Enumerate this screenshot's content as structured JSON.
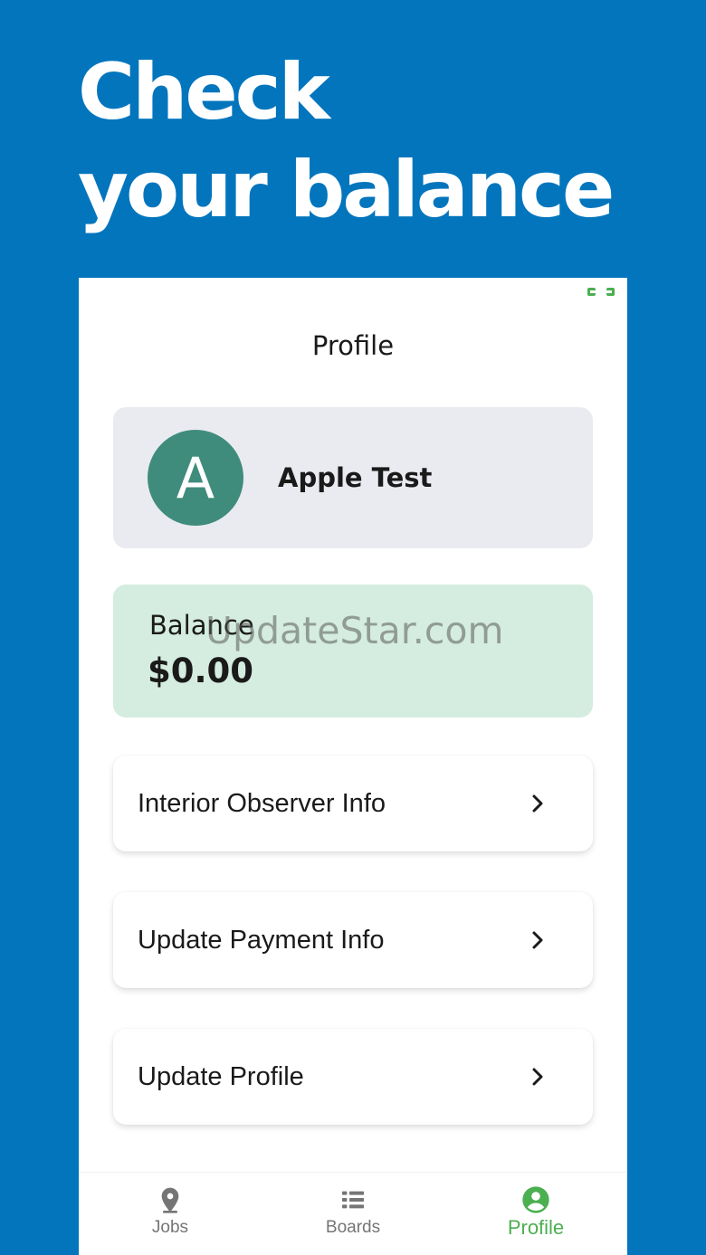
{
  "promo": {
    "line1": "Check",
    "line2": "your balance"
  },
  "screen": {
    "title": "Profile"
  },
  "user": {
    "avatar_letter": "A",
    "name": "Apple Test"
  },
  "balance": {
    "label": "Balance",
    "value": "$0.00"
  },
  "watermark": "UpdateStar.com",
  "menu": [
    {
      "label": "Interior Observer Info"
    },
    {
      "label": "Update Payment Info"
    },
    {
      "label": "Update Profile"
    }
  ],
  "tabs": [
    {
      "label": "Jobs",
      "icon": "location-pin-icon"
    },
    {
      "label": "Boards",
      "icon": "list-icon"
    },
    {
      "label": "Profile",
      "icon": "account-circle-icon",
      "active": true
    }
  ],
  "colors": {
    "background": "#0275bd",
    "avatar": "#3f8c7c",
    "balance_card": "#d4ede0",
    "user_card": "#eaebf1",
    "accent": "#4caf50",
    "inactive": "#757575"
  }
}
